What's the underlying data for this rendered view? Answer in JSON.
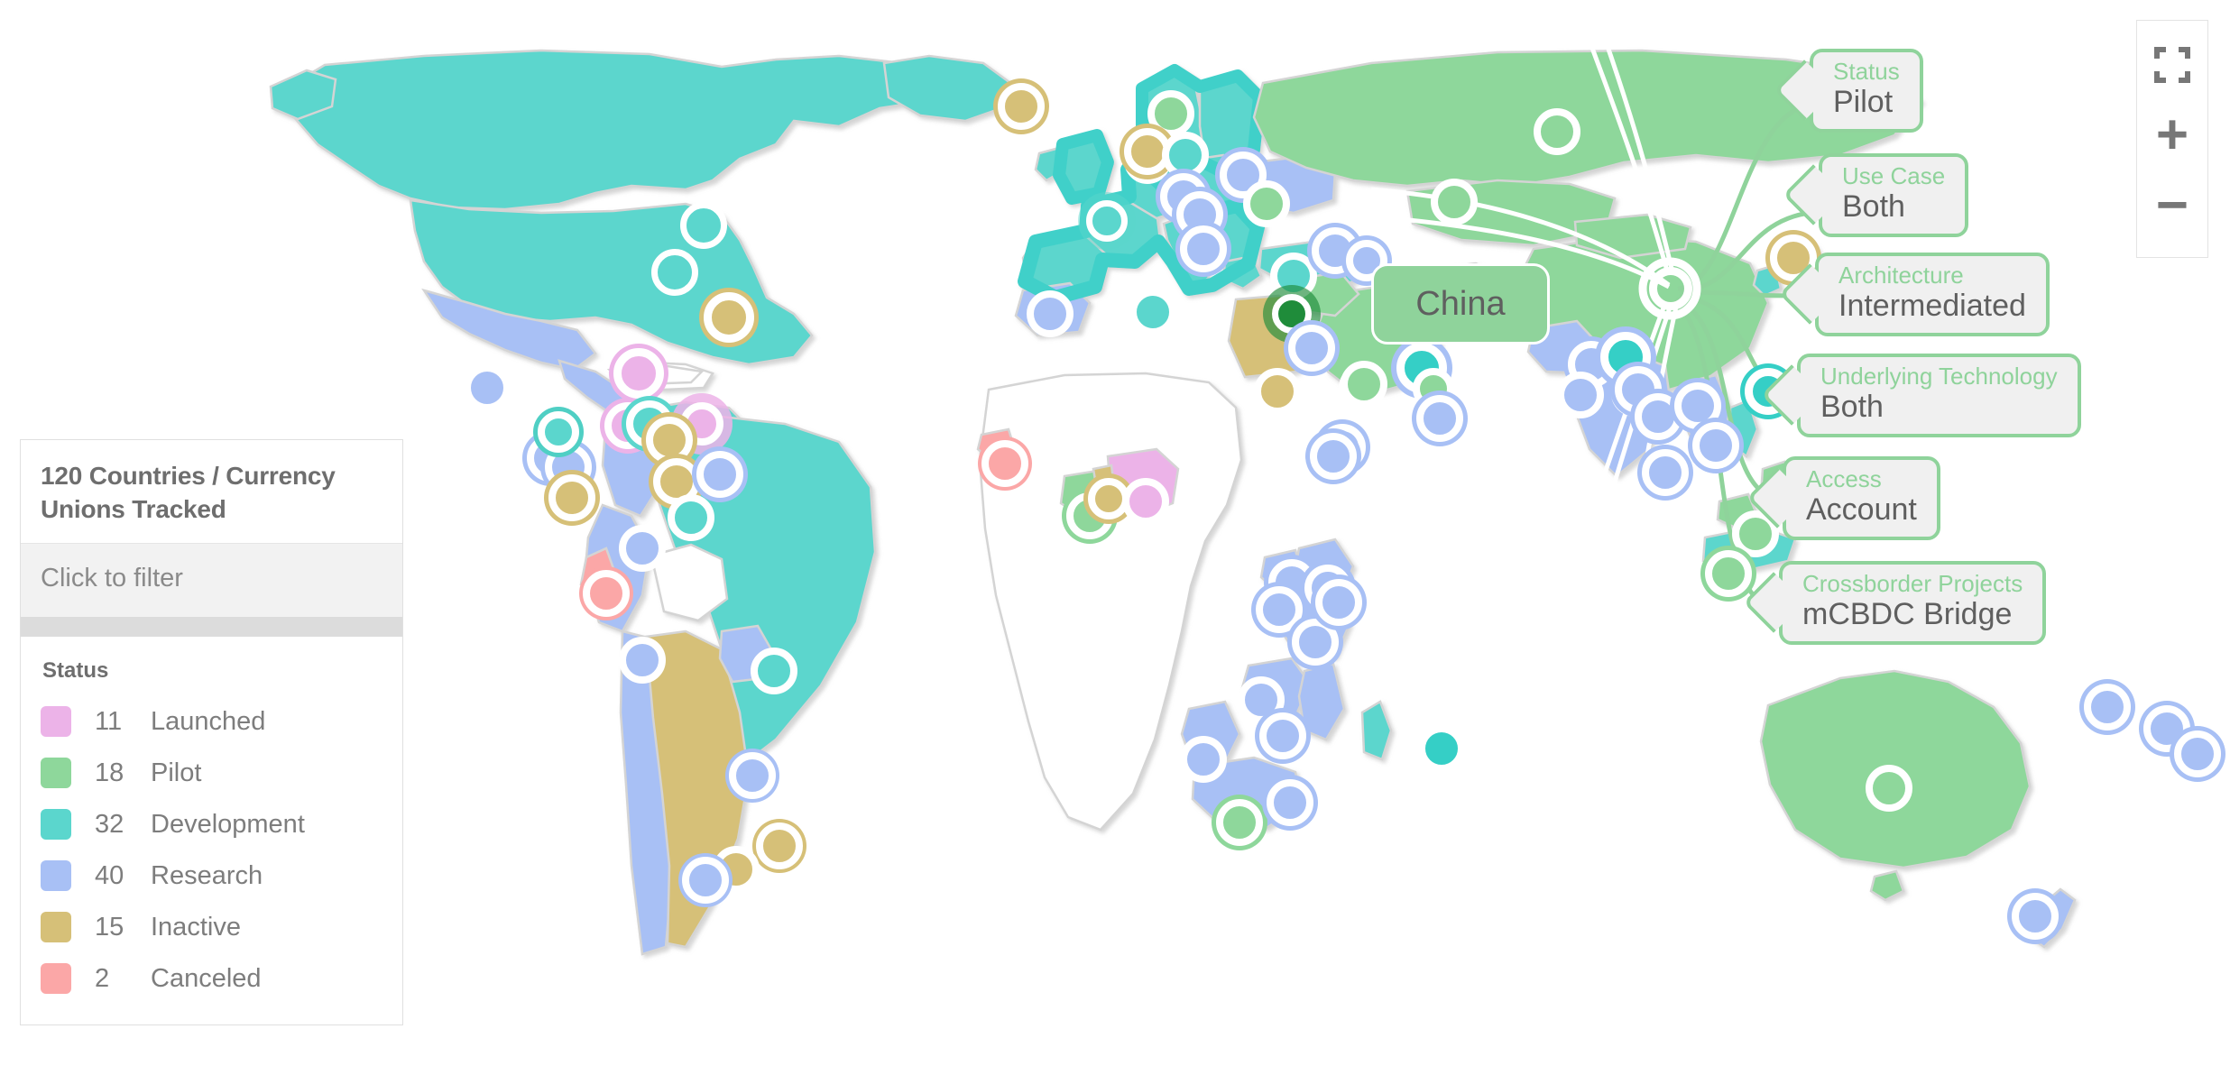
{
  "panel": {
    "title": "120 Countries / Currency Unions Tracked",
    "filter_prompt": "Click to filter",
    "status_heading": "Status",
    "legend": [
      {
        "count": "11",
        "label": "Launched",
        "color": "#ecb3e8"
      },
      {
        "count": "18",
        "label": "Pilot",
        "color": "#8ed79b"
      },
      {
        "count": "32",
        "label": "Development",
        "color": "#5bd6cd"
      },
      {
        "count": "40",
        "label": "Research",
        "color": "#a8c0f5"
      },
      {
        "count": "15",
        "label": "Inactive",
        "color": "#d6c078"
      },
      {
        "count": "2",
        "label": "Canceled",
        "color": "#fba7a7"
      }
    ]
  },
  "map": {
    "selected_country": "China",
    "callouts": [
      {
        "label": "Status",
        "value": "Pilot"
      },
      {
        "label": "Use Case",
        "value": "Both"
      },
      {
        "label": "Architecture",
        "value": "Intermediated"
      },
      {
        "label": "Underlying Technology",
        "value": "Both"
      },
      {
        "label": "Access",
        "value": "Account"
      },
      {
        "label": "Crossborder Projects",
        "value": "mCBDC Bridge"
      }
    ]
  },
  "controls": {
    "fullscreen_label": "fullscreen",
    "zoom_in_label": "+",
    "zoom_out_label": "−"
  },
  "colors": {
    "launched": "#ecb3e8",
    "pilot": "#8ed79b",
    "development": "#5bd6cd",
    "research": "#a8c0f5",
    "inactive": "#d6c078",
    "canceled": "#fba7a7",
    "land_default": "#ffffff",
    "land_border": "#d4d4d4",
    "callout_accent": "#8fd39b"
  }
}
